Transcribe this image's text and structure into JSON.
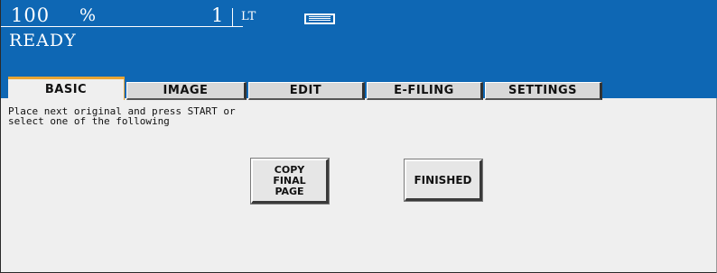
{
  "status_bar": {
    "zoom_value": "100",
    "zoom_unit": "%",
    "copy_quantity": "1",
    "paper_size": "LT",
    "paper_icon": "paper-tray-icon",
    "status": "READY"
  },
  "tabs": [
    {
      "label": "BASIC",
      "active": true
    },
    {
      "label": "IMAGE",
      "active": false
    },
    {
      "label": "EDIT",
      "active": false
    },
    {
      "label": "E-FILING",
      "active": false
    },
    {
      "label": "SETTINGS",
      "active": false
    }
  ],
  "message": {
    "line1": "Place next original and press START or",
    "line2": "select one of the following"
  },
  "buttons": {
    "copy_final_page": [
      "COPY",
      "FINAL",
      "PAGE"
    ],
    "finished": "FINISHED"
  },
  "colors": {
    "header_blue": "#0e67b4",
    "active_tab_accent": "#e8a534",
    "panel_bg": "#efefef"
  }
}
